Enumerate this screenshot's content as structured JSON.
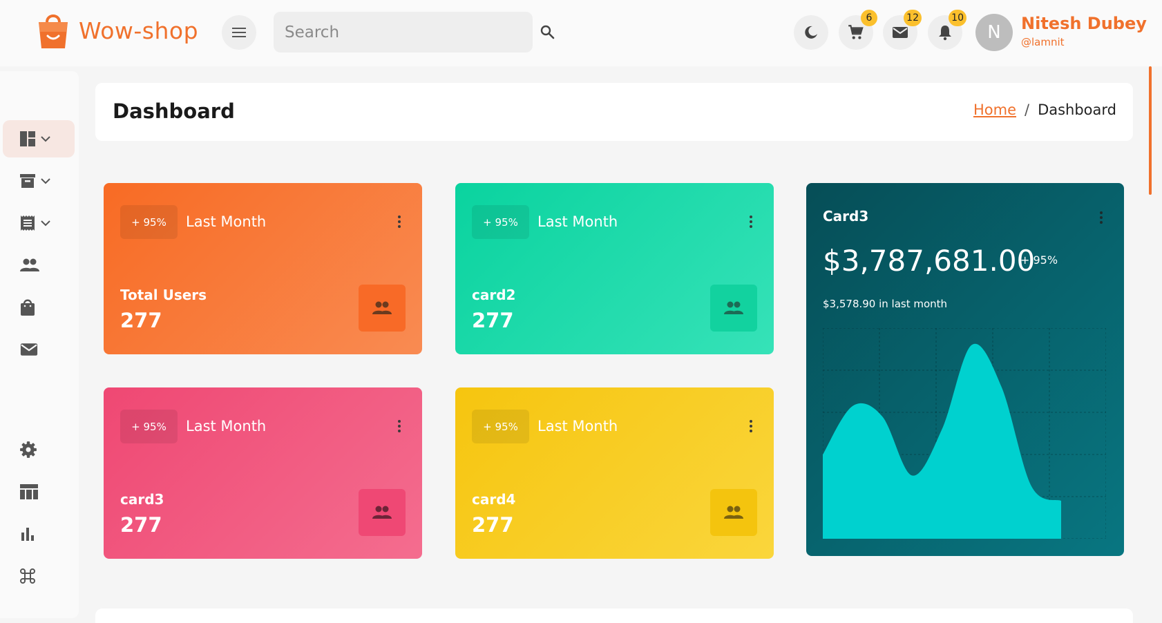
{
  "brand": {
    "name": "Wow-shop",
    "color": "#f0712c"
  },
  "header": {
    "search_placeholder": "Search",
    "cart_count": "6",
    "mail_count": "12",
    "notification_count": "10",
    "user": {
      "initial": "N",
      "name": "Nitesh Dubey",
      "handle": "@lamnit"
    }
  },
  "sidebar": {
    "items": [
      {
        "icon": "dashboard-icon",
        "has_chevron": true,
        "active": true
      },
      {
        "icon": "archive-icon",
        "has_chevron": true
      },
      {
        "icon": "receipt-icon",
        "has_chevron": true
      },
      {
        "icon": "users-icon"
      },
      {
        "icon": "shopping-bag-icon"
      },
      {
        "icon": "mail-icon"
      },
      {
        "icon": "settings-icon"
      },
      {
        "icon": "table-icon"
      },
      {
        "icon": "bar-chart-icon"
      },
      {
        "icon": "command-icon"
      }
    ]
  },
  "page": {
    "title": "Dashboard"
  },
  "breadcrumb": {
    "home": "Home",
    "separator": "/",
    "current": "Dashboard"
  },
  "cards": [
    {
      "pct": "+ 95%",
      "period": "Last Month",
      "label": "Total Users",
      "value": "277",
      "color": "#f86b24"
    },
    {
      "pct": "+ 95%",
      "period": "Last Month",
      "label": "card2",
      "value": "277",
      "color": "#0ad39f"
    },
    {
      "pct": "+ 95%",
      "period": "Last Month",
      "label": "card3",
      "value": "277",
      "color": "#ef4873"
    },
    {
      "pct": "+ 95%",
      "period": "Last Month",
      "label": "card4",
      "value": "277",
      "color": "#f6c50f"
    }
  ],
  "big_card": {
    "title": "Card3",
    "amount": "$3,787,681.00",
    "pct": "+ 95%",
    "subtitle": "$3,578.90 in last month",
    "colors": {
      "background": "#064e57",
      "area": "#00d1cf"
    }
  },
  "chart_data": {
    "type": "area",
    "x": [
      0,
      1,
      2,
      3,
      4,
      5,
      6,
      7,
      8
    ],
    "values": [
      40,
      63,
      58,
      30,
      52,
      92,
      72,
      25,
      18
    ],
    "ylim": [
      0,
      100
    ],
    "grid": true,
    "xlabel": "",
    "ylabel": ""
  }
}
